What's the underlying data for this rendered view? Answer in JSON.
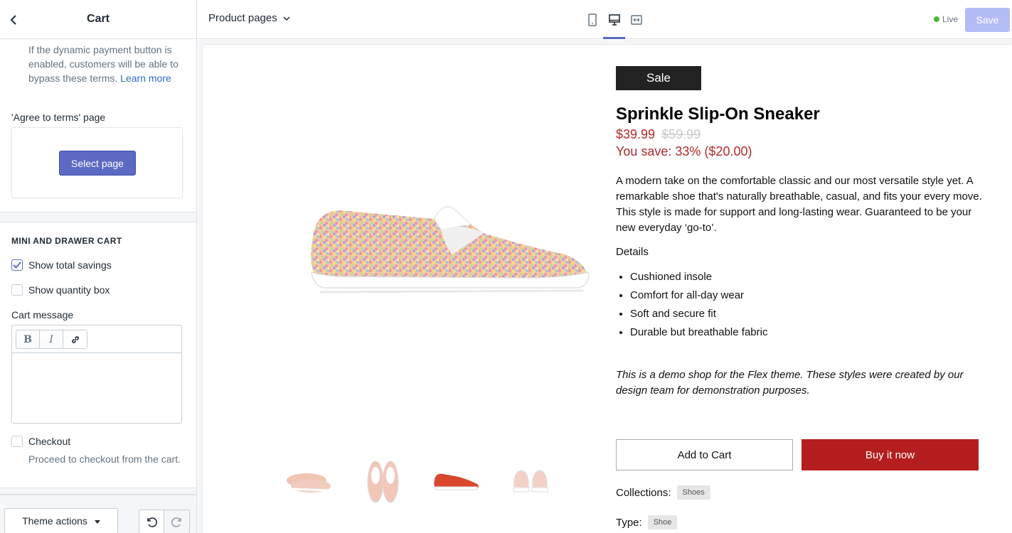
{
  "sidebar": {
    "title": "Cart",
    "help_text": "If the dynamic payment button is enabled, customers will be able to bypass these terms.",
    "learn_more": "Learn more",
    "agree_terms_label": "'Agree to terms' page",
    "select_page_label": "Select page",
    "section_heading": "MINI AND DRAWER CART",
    "show_total_savings": {
      "label": "Show total savings",
      "checked": true
    },
    "show_quantity_box": {
      "label": "Show quantity box",
      "checked": false
    },
    "cart_message_label": "Cart message",
    "rte_buttons": [
      "B",
      "I"
    ],
    "checkout": {
      "label": "Checkout",
      "checked": false,
      "help": "Proceed to checkout from the cart."
    },
    "theme_actions_label": "Theme actions"
  },
  "topbar": {
    "page_select": "Product pages",
    "live_label": "Live",
    "save_label": "Save",
    "active_device": "desktop"
  },
  "product": {
    "badge": "Sale",
    "title": "Sprinkle Slip-On Sneaker",
    "price": "$39.99",
    "compare_price": "$59.99",
    "you_save": "You save: 33% ($20.00)",
    "description": "A modern take on the comfortable classic and our most versatile style yet. A remarkable shoe that's naturally breathable, casual, and fits your every move. This style is made for support and long-lasting wear. Guaranteed to be your new everyday ‘go-to’.",
    "details_title": "Details",
    "details": [
      "Cushioned insole",
      "Comfort for all-day wear",
      "Soft and secure fit",
      "Durable but breathable fabric"
    ],
    "demo_note": "This is a demo shop for the Flex theme. These styles were created by our design team for demonstration purposes.",
    "add_to_cart": "Add to Cart",
    "buy_now": "Buy it now",
    "collections_label": "Collections:",
    "collections_tag": "Shoes",
    "type_label": "Type:",
    "type_tag": "Shoe"
  },
  "colors": {
    "accent": "#5c6ac4",
    "sale_red": "#b22a2a",
    "buy_button": "#b51e1e",
    "live_green": "#50b83c"
  }
}
